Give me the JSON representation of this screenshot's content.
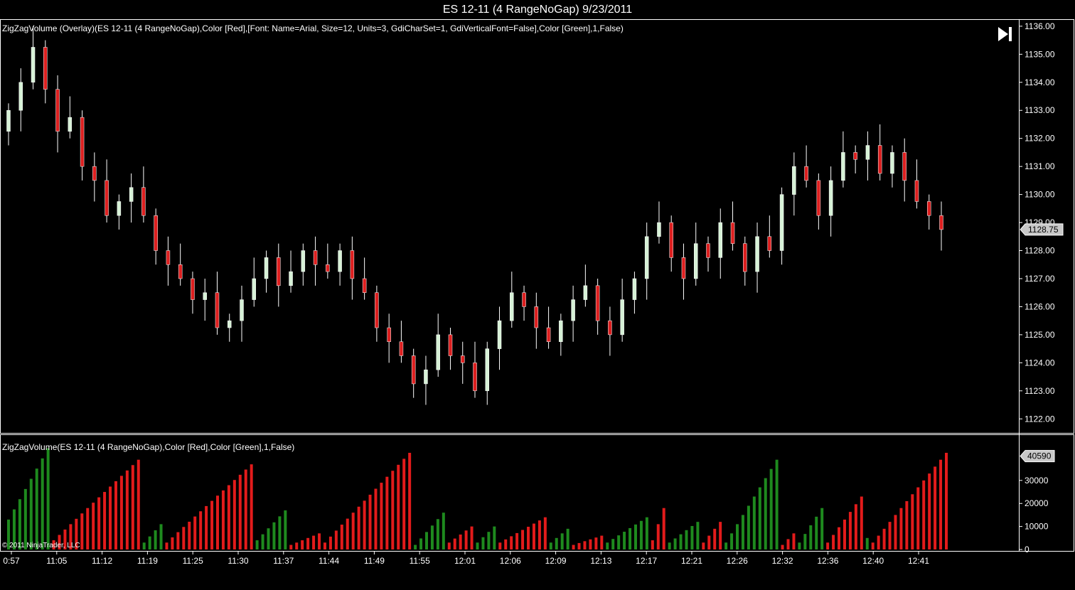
{
  "window": {
    "title": "ES 12-11 (4 RangeNoGap)  9/23/2011"
  },
  "price_panel": {
    "indicator_label": "ZigZagVolume (Overlay)(ES 12-11 (4 RangeNoGap),Color [Red],[Font: Name=Arial, Size=12, Units=3, GdiCharSet=1, GdiVerticalFont=False],Color [Green],1,False)",
    "last_price_label": "1128.75"
  },
  "volume_panel": {
    "indicator_label": "ZigZagVolume(ES 12-11 (4 RangeNoGap),Color [Red],Color [Green],1,False)",
    "last_volume_label": "40590"
  },
  "copyright": "© 2011 NinjaTrader, LLC",
  "colors": {
    "up": "#d7f2d7",
    "down": "#dd1f1f",
    "vol_up": "#1e8a1e",
    "vol_down": "#e31b1b",
    "axis": "#ffffff"
  },
  "chart_data": [
    {
      "type": "candlestick",
      "title": "ES 12-11 (4 RangeNoGap)  9/23/2011",
      "ylim": [
        1121.5,
        1136.25
      ],
      "yticks": [
        "1122.00",
        "1123.00",
        "1124.00",
        "1125.00",
        "1126.00",
        "1127.00",
        "1128.00",
        "1129.00",
        "1130.00",
        "1131.00",
        "1132.00",
        "1133.00",
        "1134.00",
        "1135.00",
        "1136.00"
      ],
      "x_tick_labels": [
        "0:57",
        "11:05",
        "11:12",
        "11:19",
        "11:25",
        "11:30",
        "11:37",
        "11:44",
        "11:49",
        "11:55",
        "12:01",
        "12:06",
        "12:09",
        "12:13",
        "12:17",
        "12:21",
        "12:26",
        "12:32",
        "12:36",
        "12:40",
        "12:41"
      ],
      "close_path": [
        1133.0,
        1134.0,
        1135.25,
        1133.75,
        1132.25,
        1132.75,
        1131.0,
        1130.5,
        1129.25,
        1129.75,
        1130.25,
        1129.25,
        1128.0,
        1127.5,
        1127.0,
        1126.25,
        1126.5,
        1125.25,
        1125.5,
        1126.25,
        1127.0,
        1127.75,
        1126.75,
        1127.25,
        1128.0,
        1127.5,
        1127.25,
        1128.0,
        1127.0,
        1126.5,
        1125.25,
        1124.75,
        1124.25,
        1123.25,
        1123.75,
        1125.0,
        1124.25,
        1124.0,
        1123.0,
        1124.5,
        1125.5,
        1126.5,
        1126.0,
        1125.25,
        1124.75,
        1125.5,
        1126.25,
        1126.75,
        1125.5,
        1125.0,
        1126.25,
        1127.0,
        1128.5,
        1129.0,
        1127.75,
        1127.0,
        1128.25,
        1127.75,
        1129.0,
        1128.25,
        1127.25,
        1128.5,
        1128.0,
        1130.0,
        1131.0,
        1130.5,
        1129.25,
        1130.5,
        1131.5,
        1131.25,
        1131.75,
        1130.75,
        1131.5,
        1130.5,
        1129.75,
        1129.25,
        1128.75
      ],
      "last_price": 1128.75
    },
    {
      "type": "bar",
      "title": "ZigZagVolume",
      "ylim": [
        0,
        42000
      ],
      "yticks": [
        "0",
        "10000",
        "20000",
        "30000"
      ],
      "last_value": 40590,
      "legs": [
        {
          "dir": "up",
          "n": 8,
          "start": 13000,
          "end": 44000
        },
        {
          "dir": "down",
          "n": 16,
          "start": 4000,
          "end": 39000
        },
        {
          "dir": "up",
          "n": 4,
          "start": 3000,
          "end": 11000
        },
        {
          "dir": "down",
          "n": 16,
          "start": 3000,
          "end": 37000
        },
        {
          "dir": "up",
          "n": 6,
          "start": 4000,
          "end": 17000
        },
        {
          "dir": "down",
          "n": 6,
          "start": 2000,
          "end": 7000
        },
        {
          "dir": "down",
          "n": 16,
          "start": 3000,
          "end": 42000
        },
        {
          "dir": "up",
          "n": 6,
          "start": 2000,
          "end": 16000
        },
        {
          "dir": "down",
          "n": 5,
          "start": 3000,
          "end": 10000
        },
        {
          "dir": "up",
          "n": 4,
          "start": 3000,
          "end": 10000
        },
        {
          "dir": "down",
          "n": 9,
          "start": 3000,
          "end": 14000
        },
        {
          "dir": "up",
          "n": 4,
          "start": 3000,
          "end": 9000
        },
        {
          "dir": "down",
          "n": 6,
          "start": 2000,
          "end": 6000
        },
        {
          "dir": "up",
          "n": 8,
          "start": 3000,
          "end": 14000
        },
        {
          "dir": "down",
          "n": 3,
          "start": 4000,
          "end": 18000
        },
        {
          "dir": "up",
          "n": 6,
          "start": 3000,
          "end": 12000
        },
        {
          "dir": "down",
          "n": 4,
          "start": 3000,
          "end": 12000
        },
        {
          "dir": "up",
          "n": 10,
          "start": 3000,
          "end": 39000
        },
        {
          "dir": "down",
          "n": 3,
          "start": 2000,
          "end": 7000
        },
        {
          "dir": "up",
          "n": 5,
          "start": 3000,
          "end": 18000
        },
        {
          "dir": "down",
          "n": 7,
          "start": 3000,
          "end": 23000
        },
        {
          "dir": "up",
          "n": 1,
          "start": 5000,
          "end": 5000
        },
        {
          "dir": "down",
          "n": 14,
          "start": 3000,
          "end": 42000
        }
      ]
    }
  ]
}
